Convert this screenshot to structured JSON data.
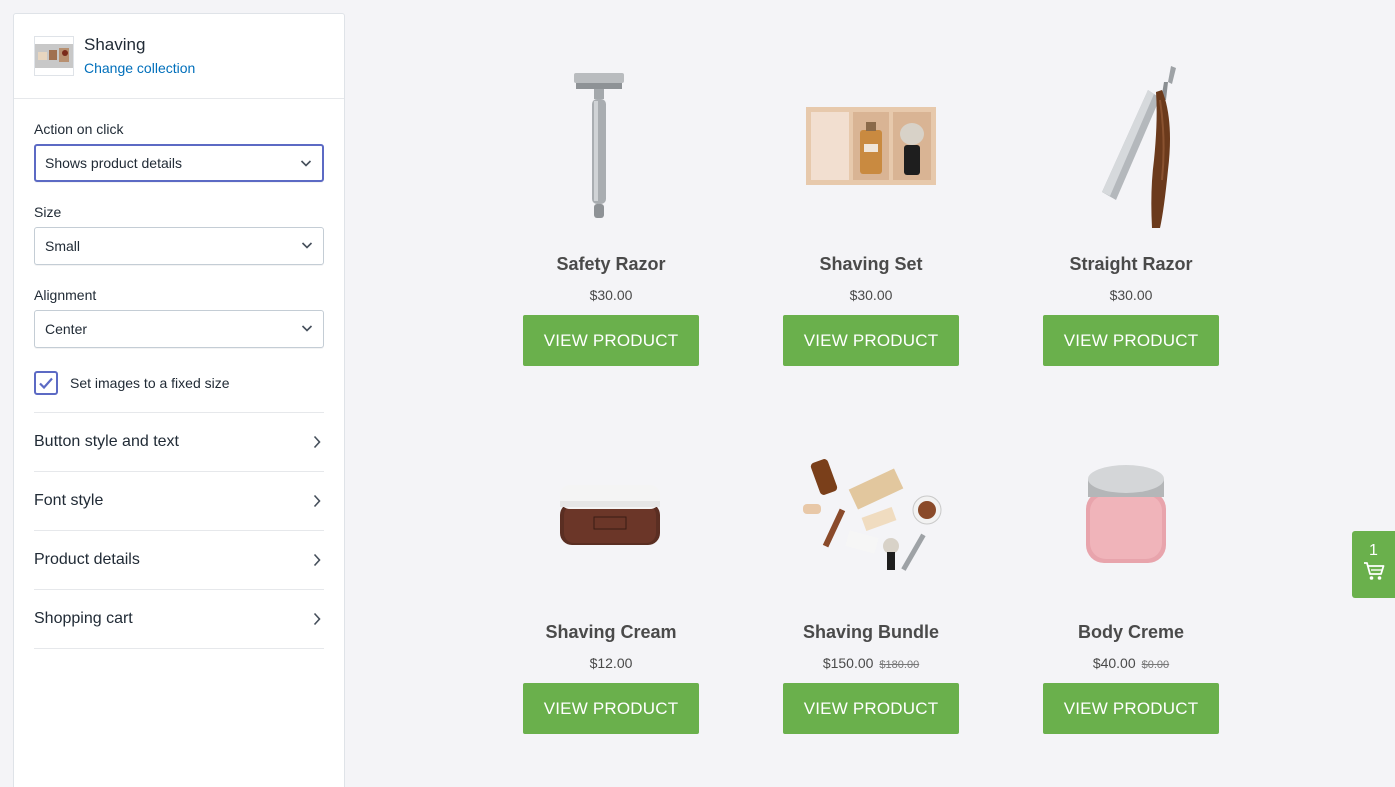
{
  "sidebar": {
    "collection": {
      "title": "Shaving",
      "change_link": "Change collection"
    },
    "action_on_click": {
      "label": "Action on click",
      "value": "Shows product details"
    },
    "size": {
      "label": "Size",
      "value": "Small"
    },
    "alignment": {
      "label": "Alignment",
      "value": "Center"
    },
    "fixed_size_checkbox": {
      "label": "Set images to a fixed size",
      "checked": true
    },
    "accordion": [
      {
        "label": "Button style and text"
      },
      {
        "label": "Font style"
      },
      {
        "label": "Product details"
      },
      {
        "label": "Shopping cart"
      }
    ]
  },
  "products": [
    {
      "title": "Safety Razor",
      "price": "$30.00",
      "compare_price": "",
      "button": "VIEW PRODUCT"
    },
    {
      "title": "Shaving Set",
      "price": "$30.00",
      "compare_price": "",
      "button": "VIEW PRODUCT"
    },
    {
      "title": "Straight Razor",
      "price": "$30.00",
      "compare_price": "",
      "button": "VIEW PRODUCT"
    },
    {
      "title": "Shaving Cream",
      "price": "$12.00",
      "compare_price": "",
      "button": "VIEW PRODUCT"
    },
    {
      "title": "Shaving Bundle",
      "price": "$150.00",
      "compare_price": "$180.00",
      "button": "VIEW PRODUCT"
    },
    {
      "title": "Body Creme",
      "price": "$40.00",
      "compare_price": "$0.00",
      "button": "VIEW PRODUCT"
    }
  ],
  "cart": {
    "count": "1",
    "icon": "cart-icon"
  },
  "colors": {
    "button_green": "#6ab04c",
    "link_blue": "#006fbb",
    "focus_indigo": "#5c6ac4",
    "background": "#f4f4f7"
  }
}
